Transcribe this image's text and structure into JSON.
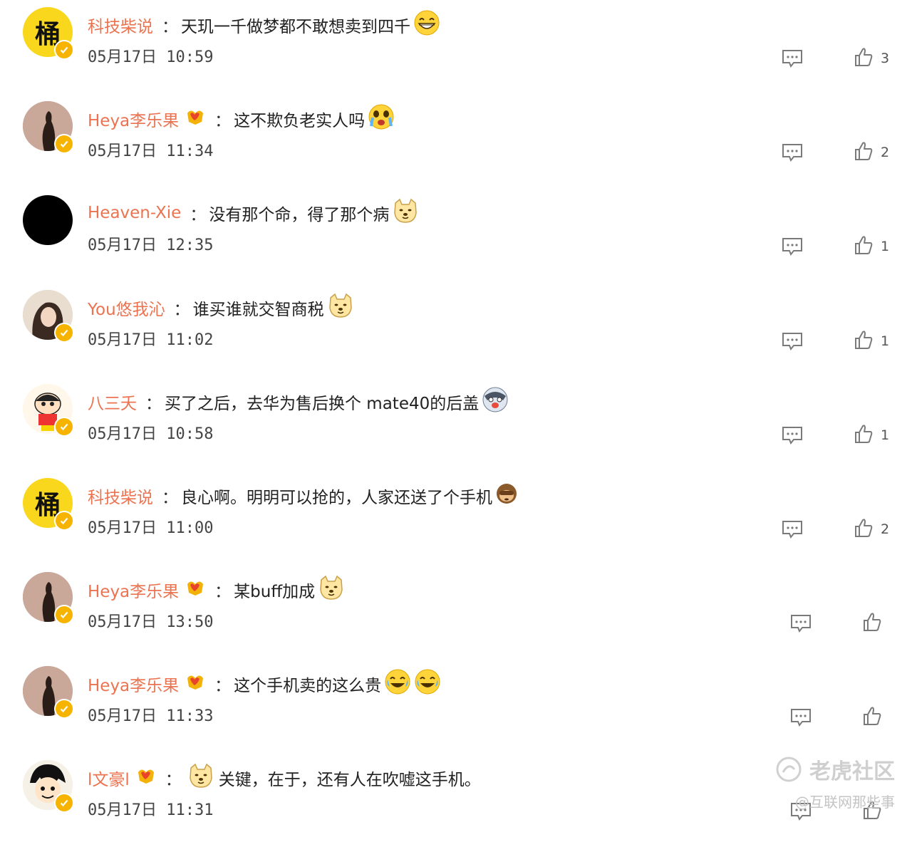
{
  "comments": [
    {
      "avatar": "yellow",
      "avatar_glyph": "桶",
      "username": "科技柴说",
      "separator": "：",
      "text": "天玑一千做梦都不敢想卖到四千",
      "emojis": [
        "grin-emoji"
      ],
      "has_badge": false,
      "time": "05月17日 10:59",
      "likes": "3"
    },
    {
      "avatar": "silhouette",
      "username": "Heya李乐果",
      "separator": "：",
      "text": "这不欺负老实人吗",
      "emojis": [
        "crying-emoji"
      ],
      "has_badge": true,
      "time": "05月17日 11:34",
      "likes": "2"
    },
    {
      "avatar": "black",
      "username": "Heaven-Xie",
      "separator": "：",
      "text": "没有那个命，得了那个病",
      "emojis": [
        "doge-emoji"
      ],
      "has_badge": false,
      "time": "05月17日 12:35",
      "likes": "1"
    },
    {
      "avatar": "photo",
      "username": "You悠我沁",
      "separator": "：",
      "text": "谁买谁就交智商税",
      "emojis": [
        "doge-emoji"
      ],
      "has_badge": false,
      "time": "05月17日 11:02",
      "likes": "1"
    },
    {
      "avatar": "cartoon",
      "username": "八三夭",
      "separator": "：",
      "text": "买了之后，去华为售后换个 mate40的后盖",
      "emojis": [
        "husky-emoji"
      ],
      "has_badge": false,
      "time": "05月17日 10:58",
      "likes": "1"
    },
    {
      "avatar": "yellow",
      "avatar_glyph": "桶",
      "username": "科技柴说",
      "separator": "：",
      "text": "良心啊。明明可以抢的，人家还送了个手机",
      "emojis": [
        "monkey-emoji"
      ],
      "has_badge": false,
      "time": "05月17日 11:00",
      "likes": "2"
    },
    {
      "avatar": "silhouette",
      "username": "Heya李乐果",
      "separator": "：",
      "text": "某buff加成",
      "emojis": [
        "doge-emoji"
      ],
      "has_badge": true,
      "time": "05月17日 13:50",
      "likes": ""
    },
    {
      "avatar": "silhouette",
      "username": "Heya李乐果",
      "separator": "：",
      "text": "这个手机卖的这么贵",
      "emojis": [
        "laugh-cry-emoji",
        "laugh-cry-emoji"
      ],
      "has_badge": true,
      "time": "05月17日 11:33",
      "likes": ""
    },
    {
      "avatar": "anime",
      "username": "l文豪l",
      "separator": "：",
      "text": "关键，在于，还有人在吹嘘这手机。",
      "emojis": [],
      "lead_emoji": "doge-emoji",
      "has_badge": true,
      "time": "05月17日 11:31",
      "likes": ""
    }
  ],
  "watermark": {
    "brand": "老虎社区",
    "sub": "@互联网那些事"
  },
  "colors": {
    "username": "#eb7350",
    "verified": "#f6b400",
    "icon": "#777777"
  }
}
